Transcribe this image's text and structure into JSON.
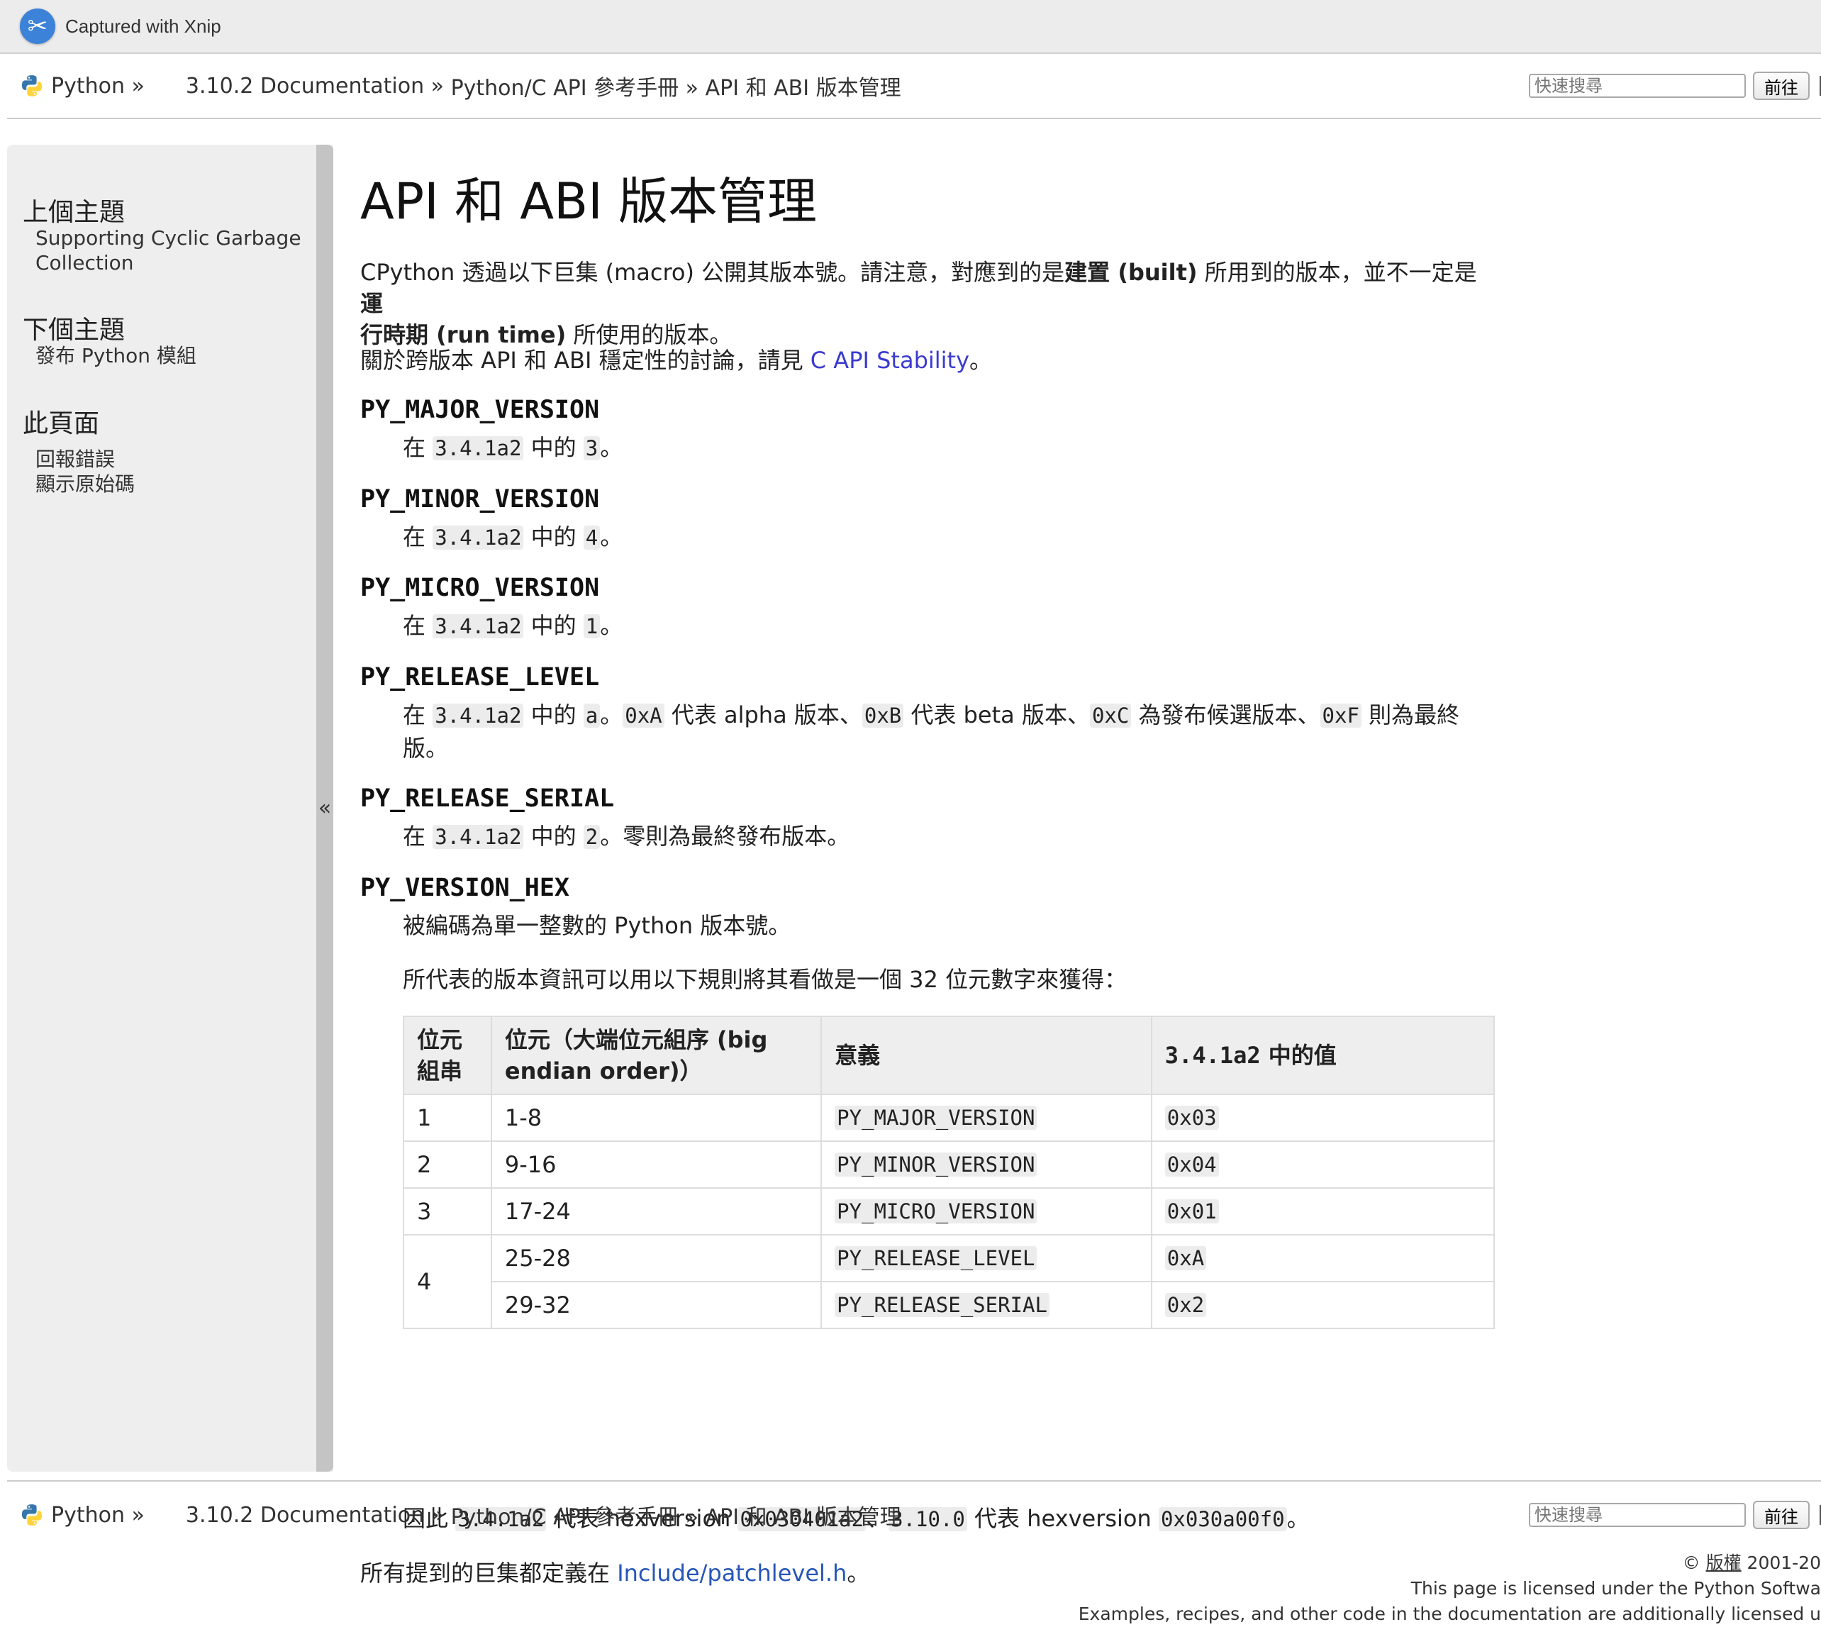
{
  "capture": {
    "label": "Captured with Xnip"
  },
  "nav": {
    "python": "Python »",
    "docs": "3.10.2 Documentation »",
    "api_ref": "Python/C API 參考手冊 »",
    "current": "API 和 ABI 版本管理",
    "search_placeholder": "快速搜尋",
    "go_label": "前往"
  },
  "sidebar": {
    "prev_heading": "上個主題",
    "prev_link_1": "Supporting Cyclic Garbage",
    "prev_link_2": "Collection",
    "next_heading": "下個主題",
    "next_link": "發布 Python 模組",
    "page_heading": "此頁面",
    "report_bug": "回報錯誤",
    "show_source": "顯示原始碼",
    "collapse": "«"
  },
  "main": {
    "title": "API 和 ABI 版本管理",
    "intro_a": "CPython 透過以下巨集 (macro) 公開其版本號。請注意，對應到的是",
    "intro_b1": "建置 (built)",
    "intro_c": " 所用到的版本，並不一定是",
    "intro_b2a": "運",
    "intro_b2b": "行時期 (run time)",
    "intro_d": " 所使用的版本。",
    "stability_a": "關於跨版本 API 和 ABI 穩定性的討論，請見 ",
    "stability_link": "C API Stability",
    "stability_b": "。",
    "macros": {
      "major": {
        "name": "PY_MAJOR_VERSION",
        "pre": "在 ",
        "ver": "3.4.1a2",
        "mid": " 中的 ",
        "val": "3",
        "post": "。"
      },
      "minor": {
        "name": "PY_MINOR_VERSION",
        "pre": "在 ",
        "ver": "3.4.1a2",
        "mid": " 中的 ",
        "val": "4",
        "post": "。"
      },
      "micro": {
        "name": "PY_MICRO_VERSION",
        "pre": "在 ",
        "ver": "3.4.1a2",
        "mid": " 中的 ",
        "val": "1",
        "post": "。"
      },
      "level": {
        "name": "PY_RELEASE_LEVEL",
        "pre": "在 ",
        "ver": "3.4.1a2",
        "mid": " 中的 ",
        "val": "a",
        "post": "。",
        "c1": "0xA",
        "t1": " 代表 alpha 版本、",
        "c2": "0xB",
        "t2": " 代表 beta 版本、",
        "c3": "0xC",
        "t3": " 為發布候選版本、",
        "c4": "0xF",
        "t4": " 則為最終",
        "t5": "版。"
      },
      "serial": {
        "name": "PY_RELEASE_SERIAL",
        "pre": "在 ",
        "ver": "3.4.1a2",
        "mid": " 中的 ",
        "val": "2",
        "post": "。零則為最終發布版本。"
      },
      "hex": {
        "name": "PY_VERSION_HEX",
        "desc": "被編碼為單一整數的 Python 版本號。",
        "rule": "所代表的版本資訊可以用以下規則將其看做是一個 32 位元數字來獲得："
      }
    },
    "table": {
      "headers": [
        "位元\n組串",
        "位元（大端位元組序 (big\nendian order)）",
        "意義",
        "3.4.1a2 中的值"
      ],
      "h0a": "位元",
      "h0b": "組串",
      "h1a": "位元（大端位元組序 (big",
      "h1b": "endian order)）",
      "h2": "意義",
      "h3_code": "3.4.1a2",
      "h3_text": " 中的值",
      "rows": [
        {
          "byte": "1",
          "bits": "1-8",
          "meaning": "PY_MAJOR_VERSION",
          "value": "0x03"
        },
        {
          "byte": "2",
          "bits": "9-16",
          "meaning": "PY_MINOR_VERSION",
          "value": "0x04"
        },
        {
          "byte": "3",
          "bits": "17-24",
          "meaning": "PY_MICRO_VERSION",
          "value": "0x01"
        },
        {
          "byte": "4",
          "bits": "25-28",
          "meaning": "PY_RELEASE_LEVEL",
          "value": "0xA"
        },
        {
          "byte": "",
          "bits": "29-32",
          "meaning": "PY_RELEASE_SERIAL",
          "value": "0x2"
        }
      ]
    },
    "hexline": {
      "a": "因此 ",
      "v1": "3.4.1a2",
      "b": " 代表 hexversion ",
      "h1": "0x030401a2",
      "c": "、",
      "v2": "3.10.0",
      "d": " 代表 hexversion ",
      "h2": "0x030a00f0",
      "e": "。"
    },
    "patchlevel": {
      "a": "所有提到的巨集都定義在 ",
      "link": "Include/patchlevel.h",
      "b": "。"
    }
  },
  "footer": {
    "copy_a": "© ",
    "copy_link": "版權",
    "copy_b": " 2001-20",
    "license": "This page is licensed under the Python Softwa",
    "examples": "Examples, recipes, and other code in the documentation are additionally licensed u"
  }
}
